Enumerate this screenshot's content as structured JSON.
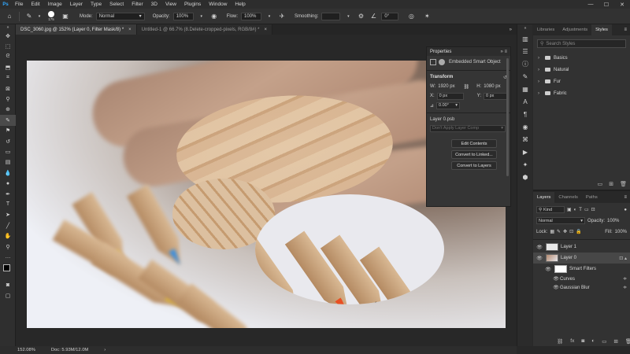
{
  "app": {
    "logo": "Ps"
  },
  "menu": [
    "File",
    "Edit",
    "Image",
    "Layer",
    "Type",
    "Select",
    "Filter",
    "3D",
    "View",
    "Plugins",
    "Window",
    "Help"
  ],
  "window_buttons": [
    "—",
    "☐",
    "✕"
  ],
  "options": {
    "brush_size": "175",
    "mode_label": "Mode:",
    "mode_value": "Normal",
    "opacity_label": "Opacity:",
    "opacity_value": "100%",
    "flow_label": "Flow:",
    "flow_value": "100%",
    "smoothing_label": "Smoothing:",
    "angle_value": "0°"
  },
  "tabs": [
    {
      "title": "DSC_3060.jpg @ 152% (Layer 0, Filter Mask/8) *",
      "close": "×"
    },
    {
      "title": "Untitled-1 @ 66.7% (8.Delete-cropped-pixels, RGB/8#) *",
      "close": "×"
    }
  ],
  "properties": {
    "title": "Properties",
    "header_right": "»  ≡",
    "object_type": "Embedded Smart Object",
    "transform_heading": "Transform",
    "w_label": "W:",
    "w_value": "1920 px",
    "h_label": "H:",
    "h_value": "1080 px",
    "x_label": "X:",
    "x_value": "0 px",
    "y_label": "Y:",
    "y_value": "0 px",
    "angle_value": "0.00°",
    "file_name": "Layer 0.psb",
    "layer_comp_placeholder": "Don't Apply Layer Comp",
    "btn_edit": "Edit Contents",
    "btn_linked": "Convert to Linked...",
    "btn_layers": "Convert to Layers"
  },
  "styles_panel": {
    "tabs": [
      "Libraries",
      "Adjustments",
      "Styles"
    ],
    "search_placeholder": "Search Styles",
    "folders": [
      "Basics",
      "Natural",
      "Fur",
      "Fabric"
    ]
  },
  "layers_panel": {
    "tabs": [
      "Layers",
      "Channels",
      "Paths"
    ],
    "kind": "Kind",
    "blend_mode": "Normal",
    "opacity_label": "Opacity:",
    "opacity_value": "100%",
    "lock_label": "Lock:",
    "fill_label": "Fill:",
    "fill_value": "100%",
    "layers": [
      {
        "name": "Layer 1"
      },
      {
        "name": "Layer 0"
      },
      {
        "name": "Smart Filters"
      },
      {
        "name": "Curves"
      },
      {
        "name": "Gaussian Blur"
      }
    ]
  },
  "status": {
    "zoom": "152.08%",
    "doc": "Doc: 5.93M/12.0M"
  },
  "colors": {
    "accent": "#31a8ff",
    "panel": "#323232",
    "background": "#282828"
  }
}
